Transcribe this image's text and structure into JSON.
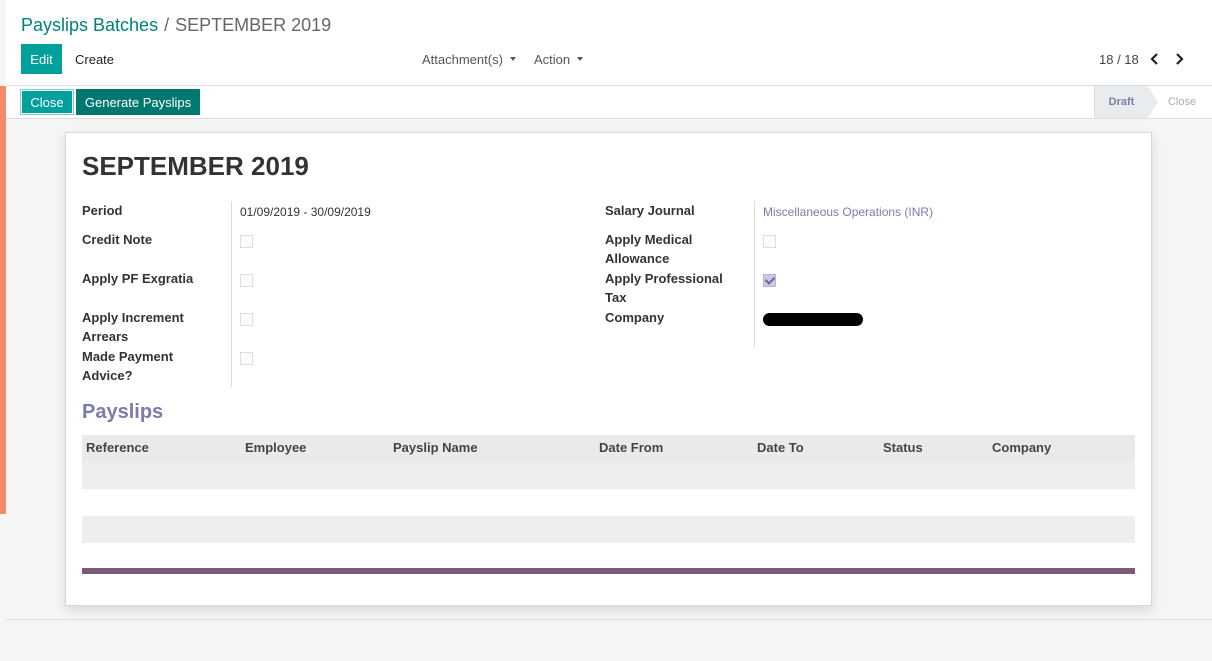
{
  "breadcrumb": {
    "parent": "Payslips Batches",
    "separator": "/",
    "current": "SEPTEMBER 2019"
  },
  "toolbar": {
    "edit_label": "Edit",
    "create_label": "Create",
    "attachments_label": "Attachment(s)",
    "action_label": "Action"
  },
  "pager": {
    "value": "18 / 18"
  },
  "statusbar": {
    "close_label": "Close",
    "generate_label": "Generate Payslips",
    "stages": [
      "Draft",
      "Close"
    ],
    "active_stage": "Draft"
  },
  "form": {
    "title": "SEPTEMBER 2019",
    "left_fields": [
      {
        "label": "Period",
        "value": "01/09/2019 - 30/09/2019"
      },
      {
        "label": "Credit Note",
        "checked": false
      },
      {
        "label": "Apply PF Exgratia",
        "checked": false
      },
      {
        "label_line1": "Apply Increment",
        "label_line2": "Arrears",
        "checked": false
      },
      {
        "label_line1": "Made Payment",
        "label_line2": "Advice?",
        "checked": false
      }
    ],
    "right_fields": [
      {
        "label": "Salary Journal",
        "value": "Miscellaneous Operations (INR)"
      },
      {
        "label_line1": "Apply Medical",
        "label_line2": "Allowance",
        "checked": false
      },
      {
        "label_line1": "Apply Professional",
        "label_line2": "Tax",
        "checked": true
      },
      {
        "label": "Company",
        "value_redacted": true
      }
    ]
  },
  "payslips": {
    "title": "Payslips",
    "columns": [
      "Reference",
      "Employee",
      "Payslip Name",
      "Date From",
      "Date To",
      "Status",
      "Company"
    ],
    "rows": []
  },
  "colors": {
    "primary": "#00a09d",
    "dark_primary": "#00776f",
    "accent_link": "#7c7bad",
    "stripe": "#f38c66",
    "table_footer": "#7a5c7a"
  }
}
